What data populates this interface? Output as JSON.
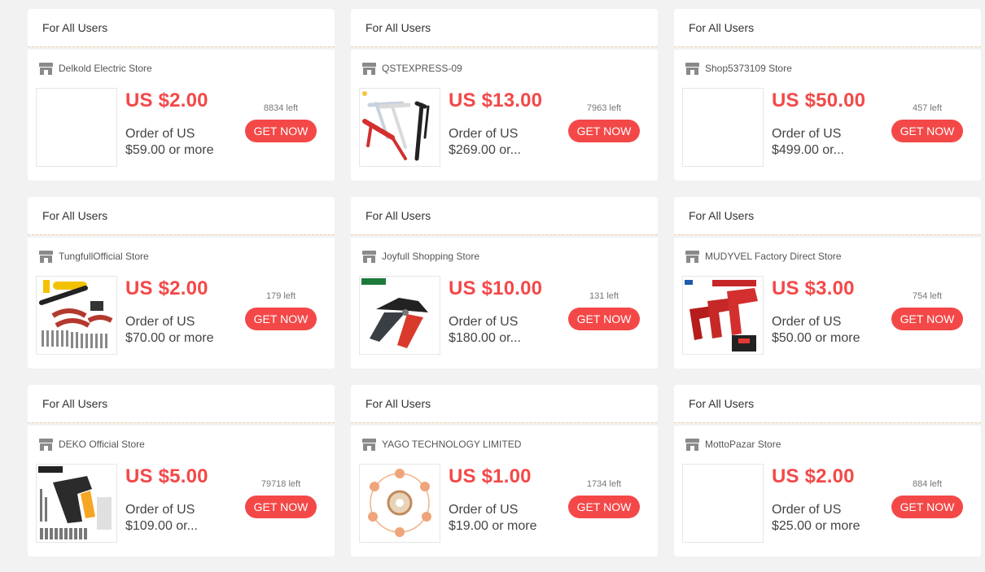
{
  "coupons": [
    {
      "header": "For All Users",
      "store": "Delkold Electric Store",
      "price": "US $2.00",
      "cond1": "Order of US",
      "cond2": "$59.00 or more",
      "left": "8834 left",
      "button": "GET NOW",
      "image": "blank"
    },
    {
      "header": "For All Users",
      "store": "QSTEXPRESS-09",
      "price": "US $13.00",
      "cond1": "Order of US",
      "cond2": "$269.00 or...",
      "left": "7963 left",
      "button": "GET NOW",
      "image": "calipers"
    },
    {
      "header": "For All Users",
      "store": "Shop5373109 Store",
      "price": "US $50.00",
      "cond1": "Order of US",
      "cond2": "$499.00 or...",
      "left": "457 left",
      "button": "GET NOW",
      "image": "blank"
    },
    {
      "header": "For All Users",
      "store": "TungfullOfficial Store",
      "price": "US $2.00",
      "cond1": "Order of US",
      "cond2": "$70.00 or more",
      "left": "179 left",
      "button": "GET NOW",
      "image": "rotary-tool-kit"
    },
    {
      "header": "For All Users",
      "store": "Joyfull Shopping Store",
      "price": "US $10.00",
      "cond1": "Order of US",
      "cond2": "$180.00 or...",
      "left": "131 left",
      "button": "GET NOW",
      "image": "wire-stripper"
    },
    {
      "header": "For All Users",
      "store": "MUDYVEL Factory Direct Store",
      "price": "US $3.00",
      "cond1": "Order of US",
      "cond2": "$50.00 or more",
      "left": "754 left",
      "button": "GET NOW",
      "image": "drills"
    },
    {
      "header": "For All Users",
      "store": "DEKO Official Store",
      "price": "US $5.00",
      "cond1": "Order of US",
      "cond2": "$109.00 or...",
      "left": "79718 left",
      "button": "GET NOW",
      "image": "screwdriver-kit"
    },
    {
      "header": "For All Users",
      "store": "YAGO TECHNOLOGY LIMITED",
      "price": "US $1.00",
      "cond1": "Order of US",
      "cond2": "$19.00 or more",
      "left": "1734 left",
      "button": "GET NOW",
      "image": "solder-wire"
    },
    {
      "header": "For All Users",
      "store": "MottoPazar Store",
      "price": "US $2.00",
      "cond1": "Order of US",
      "cond2": "$25.00 or more",
      "left": "884 left",
      "button": "GET NOW",
      "image": "blank"
    }
  ],
  "colors": {
    "accent": "#f44848",
    "page_bg": "#f2f2f2",
    "separator": "#f7cfa6"
  }
}
